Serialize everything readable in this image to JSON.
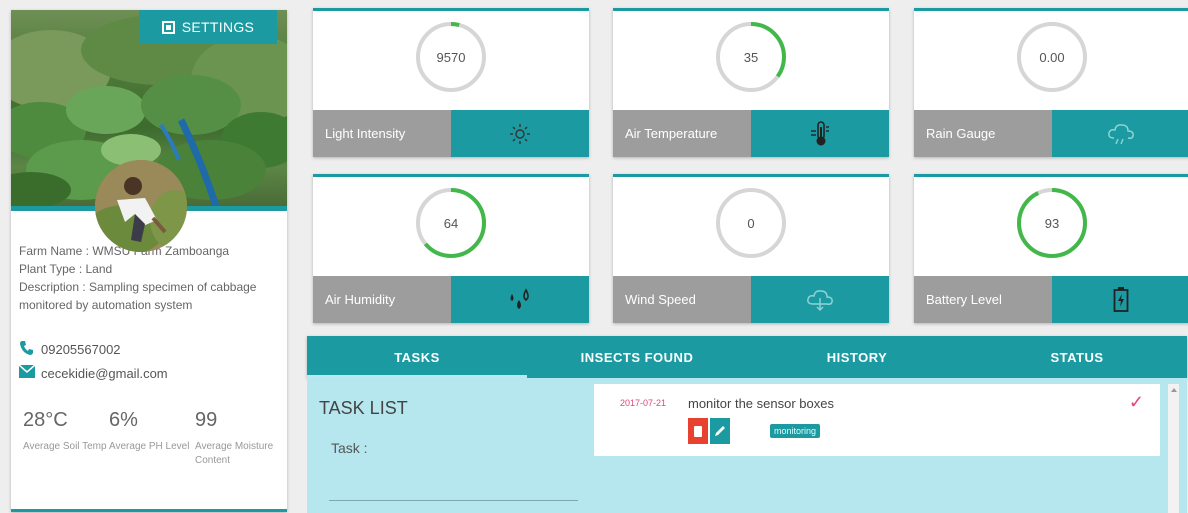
{
  "profile": {
    "settings_label": "SETTINGS",
    "farm_name_label": "Farm Name : ",
    "farm_name": "WMSU Farm Zamboanga",
    "plant_type_label": "Plant Type : ",
    "plant_type": "Land",
    "description_label": "Description : ",
    "description": "Sampling specimen of cabbage monitored by automation system",
    "phone": "09205567002",
    "email": "cecekidie@gmail.com",
    "stats": [
      {
        "value": "28°C",
        "label": "Average Soil Temp"
      },
      {
        "value": "6%",
        "label": "Average PH Level"
      },
      {
        "value": "99",
        "label": "Average Moisture Content"
      }
    ]
  },
  "sensors": [
    {
      "label": "Light Intensity",
      "value": "9570",
      "fill": 0.04,
      "icon": "sun-icon"
    },
    {
      "label": "Air Temperature",
      "value": "35",
      "fill": 0.35,
      "icon": "thermometer-icon"
    },
    {
      "label": "Rain Gauge",
      "value": "0.00",
      "fill": 0,
      "icon": "cloud-icon"
    },
    {
      "label": "Air Humidity",
      "value": "64",
      "fill": 0.64,
      "icon": "droplets-icon"
    },
    {
      "label": "Wind Speed",
      "value": "0",
      "fill": 0,
      "icon": "cloud-icon"
    },
    {
      "label": "Battery Level",
      "value": "93",
      "fill": 0.93,
      "icon": "battery-icon"
    }
  ],
  "colors": {
    "accent": "#1b9ba1",
    "gauge": "#43b84a",
    "gauge_track": "#d6d6d6",
    "label_bg": "#9d9d9d",
    "delete": "#e8412f",
    "date": "#e0457b"
  },
  "tabs": [
    {
      "label": "TASKS",
      "active": true
    },
    {
      "label": "INSECTS FOUND",
      "active": false
    },
    {
      "label": "HISTORY",
      "active": false
    },
    {
      "label": "STATUS",
      "active": false
    }
  ],
  "tasks": {
    "title": "TASK LIST",
    "task_label": "Task :",
    "items": [
      {
        "date": "2017-07-21",
        "text": "monitor the sensor boxes",
        "status": "monitoring"
      }
    ]
  }
}
